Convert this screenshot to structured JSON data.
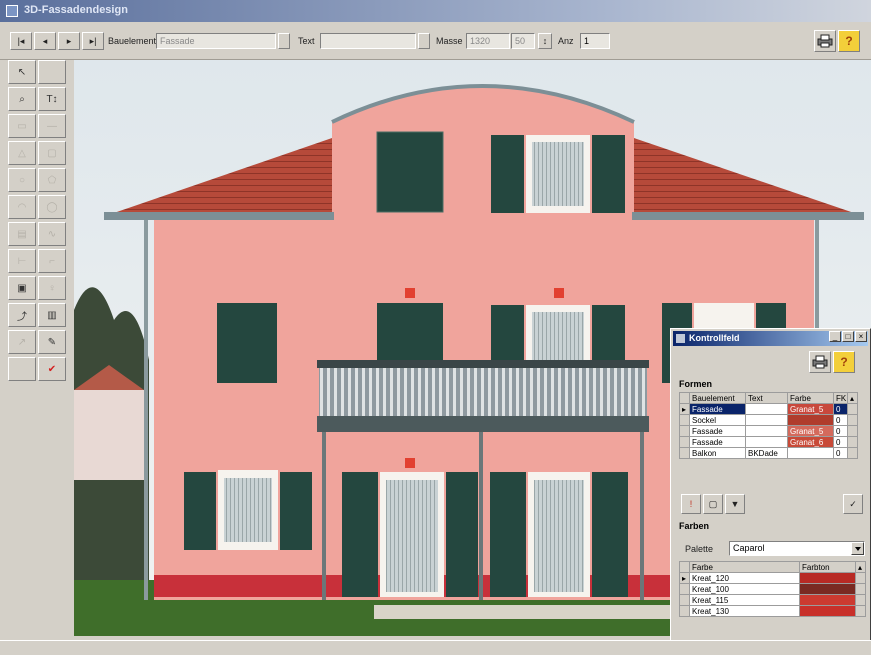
{
  "window": {
    "title": "3D-Fassadendesign"
  },
  "toolbar": {
    "first_label": "|◂",
    "prev_label": "◂",
    "next_label": "▸",
    "last_label": "▸|",
    "bauelement_label": "Bauelement",
    "bauelement_value": "Fassade",
    "text_label": "Text",
    "text_value": "",
    "masse_label": "Masse",
    "masse_value": "1320",
    "masse_value2": "50",
    "anz_label": "Anz",
    "anz_value": "1",
    "print_icon": "printer-icon",
    "help_icon": "help-icon",
    "help_label": "?"
  },
  "palette": {
    "tools": [
      {
        "name": "pointer-tool",
        "glyph": "↖",
        "dim": false
      },
      {
        "name": "blank-tool",
        "glyph": "",
        "dim": false
      },
      {
        "name": "zoom-tool",
        "glyph": "⌕",
        "dim": false
      },
      {
        "name": "text-tool",
        "glyph": "T↕",
        "dim": false
      },
      {
        "name": "rect-tool",
        "glyph": "▭",
        "dim": true
      },
      {
        "name": "line-tool",
        "glyph": "—",
        "dim": true
      },
      {
        "name": "triangle-tool",
        "glyph": "△",
        "dim": true
      },
      {
        "name": "frame-tool",
        "glyph": "▢",
        "dim": true
      },
      {
        "name": "circle-tool",
        "glyph": "○",
        "dim": true
      },
      {
        "name": "polygon-tool",
        "glyph": "⬠",
        "dim": true
      },
      {
        "name": "arc-tool",
        "glyph": "◠",
        "dim": true
      },
      {
        "name": "ellipse-tool",
        "glyph": "◯",
        "dim": true
      },
      {
        "name": "grid-tool",
        "glyph": "▤",
        "dim": true
      },
      {
        "name": "wave-tool",
        "glyph": "∿",
        "dim": true
      },
      {
        "name": "measure-tool",
        "glyph": "⊢",
        "dim": true
      },
      {
        "name": "corner-tool",
        "glyph": "⌐",
        "dim": true
      },
      {
        "name": "image-tool",
        "glyph": "▣",
        "dim": false
      },
      {
        "name": "lamp-tool",
        "glyph": "♀",
        "dim": true
      },
      {
        "name": "curve-tool",
        "glyph": "⤴",
        "dim": false
      },
      {
        "name": "book-tool",
        "glyph": "▥",
        "dim": false
      },
      {
        "name": "arrow-tool",
        "glyph": "↗",
        "dim": true
      },
      {
        "name": "brush-tool",
        "glyph": "✎",
        "dim": false
      },
      {
        "name": "empty-tool",
        "glyph": "",
        "dim": false
      },
      {
        "name": "paint-tool",
        "glyph": "✔",
        "dim": false
      }
    ]
  },
  "dialog": {
    "title": "Kontrollfeld",
    "print_icon": "printer-icon",
    "help_label": "?",
    "formen_label": "Formen",
    "formen_headers": [
      "Bauelement",
      "Text",
      "Farbe",
      "FK"
    ],
    "formen_rows": [
      {
        "bauelement": "Fassade",
        "text": "",
        "farbe": "Granat_5",
        "fk": "0",
        "swatch": "#c8483c",
        "selected": true
      },
      {
        "bauelement": "Sockel",
        "text": "",
        "farbe": "",
        "fk": "0",
        "swatch": "#b03c2c",
        "selected": false
      },
      {
        "bauelement": "Fassade",
        "text": "",
        "farbe": "Granat_5",
        "fk": "0",
        "swatch": "#d46a5c",
        "selected": false
      },
      {
        "bauelement": "Fassade",
        "text": "",
        "farbe": "Granat_6",
        "fk": "0",
        "swatch": "#c84a38",
        "selected": false
      },
      {
        "bauelement": "Balkon",
        "text": "BKDade",
        "farbe": "",
        "fk": "0",
        "swatch": "#ffffff",
        "selected": false
      }
    ],
    "farben_label": "Farben",
    "palette_label": "Palette",
    "palette_value": "Caparol",
    "farben_headers": [
      "Farbe",
      "Farbton"
    ],
    "farben_rows": [
      {
        "name": "Kreat_120",
        "color": "#b82a24"
      },
      {
        "name": "Kreat_100",
        "color": "#7a2a22"
      },
      {
        "name": "Kreat_115",
        "color": "#cc3a30"
      },
      {
        "name": "Kreat_130",
        "color": "#c8302a"
      }
    ]
  },
  "colors": {
    "facade": "#f0a49c",
    "roof": "#b8493a",
    "shutter": "#24473f",
    "sky": "#e9eef1"
  }
}
